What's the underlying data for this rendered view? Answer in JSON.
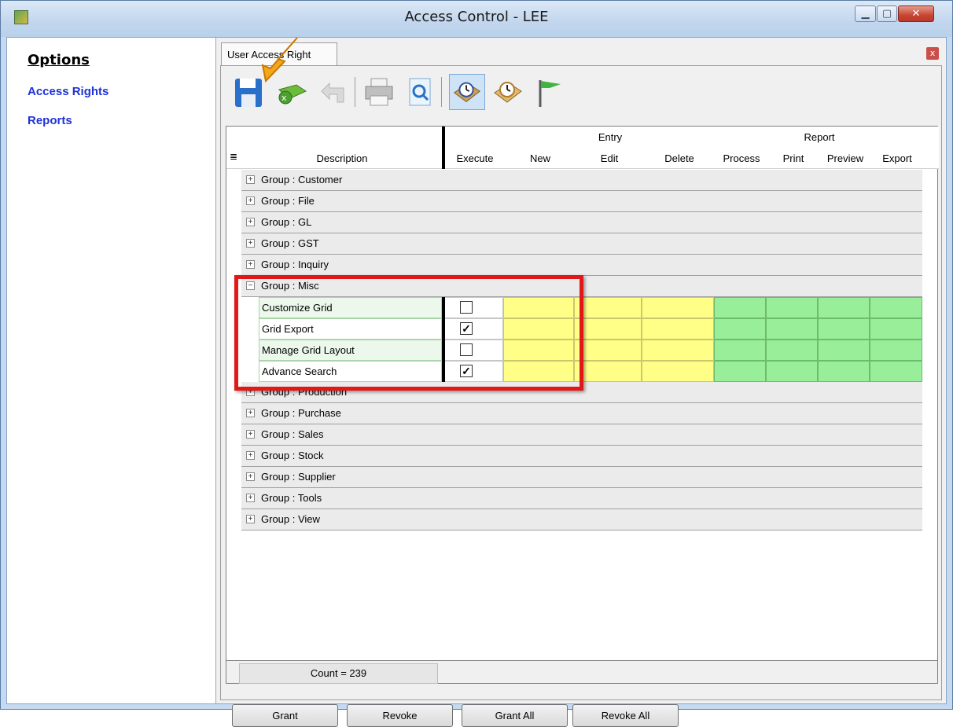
{
  "window": {
    "title": "Access Control - LEE"
  },
  "sidebar": {
    "heading": "Options",
    "items": [
      {
        "label": "Access Rights"
      },
      {
        "label": "Reports"
      }
    ]
  },
  "tab": {
    "label": "User Access Right"
  },
  "toolbar": {
    "buttons": [
      "save-icon",
      "discard-icon",
      "undo-icon",
      "print-icon",
      "preview-icon",
      "clock-icon",
      "clock-alt-icon",
      "flag-icon"
    ]
  },
  "grid": {
    "groups_header": {
      "entry": "Entry",
      "report": "Report"
    },
    "columns": [
      "Description",
      "Execute",
      "New",
      "Edit",
      "Delete",
      "Process",
      "Print",
      "Preview",
      "Export"
    ],
    "groups_before": [
      "Group : Customer",
      "Group : File",
      "Group : GL",
      "Group : GST",
      "Group : Inquiry"
    ],
    "expanded_group": {
      "label": "Group : Misc",
      "items": [
        {
          "label": "Customize Grid",
          "execute": false
        },
        {
          "label": "Grid Export",
          "execute": true
        },
        {
          "label": "Manage Grid Layout",
          "execute": false
        },
        {
          "label": "Advance Search",
          "execute": true
        }
      ]
    },
    "groups_after": [
      "Group : Production",
      "Group : Purchase",
      "Group : Sales",
      "Group : Stock",
      "Group : Supplier",
      "Group : Tools",
      "Group : View"
    ],
    "count": "Count = 239"
  },
  "buttons": {
    "grant": "Grant",
    "revoke": "Revoke",
    "grant_all": "Grant All",
    "revoke_all": "Revoke All"
  },
  "colors": {
    "entry_cell": "#ffff88",
    "report_cell": "#99ee99",
    "highlight": "#e21818",
    "link": "#1e32d6"
  }
}
